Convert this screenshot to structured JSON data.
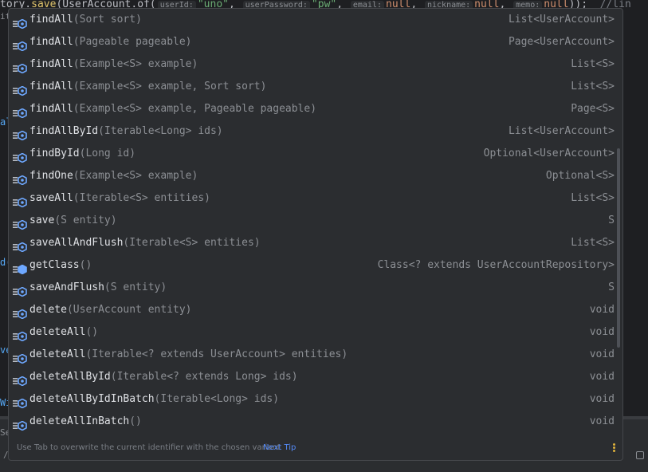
{
  "editor": {
    "code_prefix": "tory.",
    "code_method": "save",
    "code_call": "(UserAccount.of(",
    "hint_userid": "userId:",
    "str_uno": "\"uno\"",
    "hint_userpassword": "userPassword:",
    "str_pw": "\"pw\"",
    "hint_email": "email:",
    "null1": "null",
    "hint_nickname": "nickname:",
    "null2": "null",
    "hint_memo": "memo:",
    "null3": "null",
    "code_end": "));",
    "trailing_hint": "//lin",
    "left_frags": [
      "iti",
      "al",
      "d(",
      "ve",
      "Wi",
      "Se",
      "/"
    ]
  },
  "completion": {
    "items": [
      {
        "name": "findAll",
        "params": "(Sort sort)",
        "ret": "List<UserAccount>",
        "icon": "method-icon"
      },
      {
        "name": "findAll",
        "params": "(Pageable pageable)",
        "ret": "Page<UserAccount>",
        "icon": "method-icon"
      },
      {
        "name": "findAll",
        "params": "(Example<S> example)",
        "ret": "List<S>",
        "icon": "method-icon"
      },
      {
        "name": "findAll",
        "params": "(Example<S> example, Sort sort)",
        "ret": "List<S>",
        "icon": "method-icon"
      },
      {
        "name": "findAll",
        "params": "(Example<S> example, Pageable pageable)",
        "ret": "Page<S>",
        "icon": "method-icon"
      },
      {
        "name": "findAllById",
        "params": "(Iterable<Long> ids)",
        "ret": "List<UserAccount>",
        "icon": "method-icon"
      },
      {
        "name": "findById",
        "params": "(Long id)",
        "ret": "Optional<UserAccount>",
        "icon": "method-icon"
      },
      {
        "name": "findOne",
        "params": "(Example<S> example)",
        "ret": "Optional<S>",
        "icon": "method-icon"
      },
      {
        "name": "saveAll",
        "params": "(Iterable<S> entities)",
        "ret": "List<S>",
        "icon": "method-icon"
      },
      {
        "name": "save",
        "params": "(S entity)",
        "ret": "S",
        "icon": "method-icon"
      },
      {
        "name": "saveAllAndFlush",
        "params": "(Iterable<S> entities)",
        "ret": "List<S>",
        "icon": "method-icon"
      },
      {
        "name": "getClass",
        "params": "()",
        "ret": "Class<? extends UserAccountRepository>",
        "icon": "final-method-icon"
      },
      {
        "name": "saveAndFlush",
        "params": "(S entity)",
        "ret": "S",
        "icon": "method-icon"
      },
      {
        "name": "delete",
        "params": "(UserAccount entity)",
        "ret": "void",
        "icon": "method-icon"
      },
      {
        "name": "deleteAll",
        "params": "()",
        "ret": "void",
        "icon": "method-icon"
      },
      {
        "name": "deleteAll",
        "params": "(Iterable<? extends UserAccount> entities)",
        "ret": "void",
        "icon": "method-icon"
      },
      {
        "name": "deleteAllById",
        "params": "(Iterable<? extends Long> ids)",
        "ret": "void",
        "icon": "method-icon"
      },
      {
        "name": "deleteAllByIdInBatch",
        "params": "(Iterable<Long> ids)",
        "ret": "void",
        "icon": "method-icon"
      },
      {
        "name": "deleteAllInBatch",
        "params": "()",
        "ret": "void",
        "icon": "method-icon"
      }
    ],
    "footer_tip": "Use Tab to overwrite the current identifier with the chosen variant",
    "footer_link": "Next Tip"
  },
  "colors": {
    "icon_blue": "#6ea8ff",
    "icon_stripe": "#b8bcc4",
    "accent_link": "#548af7"
  }
}
